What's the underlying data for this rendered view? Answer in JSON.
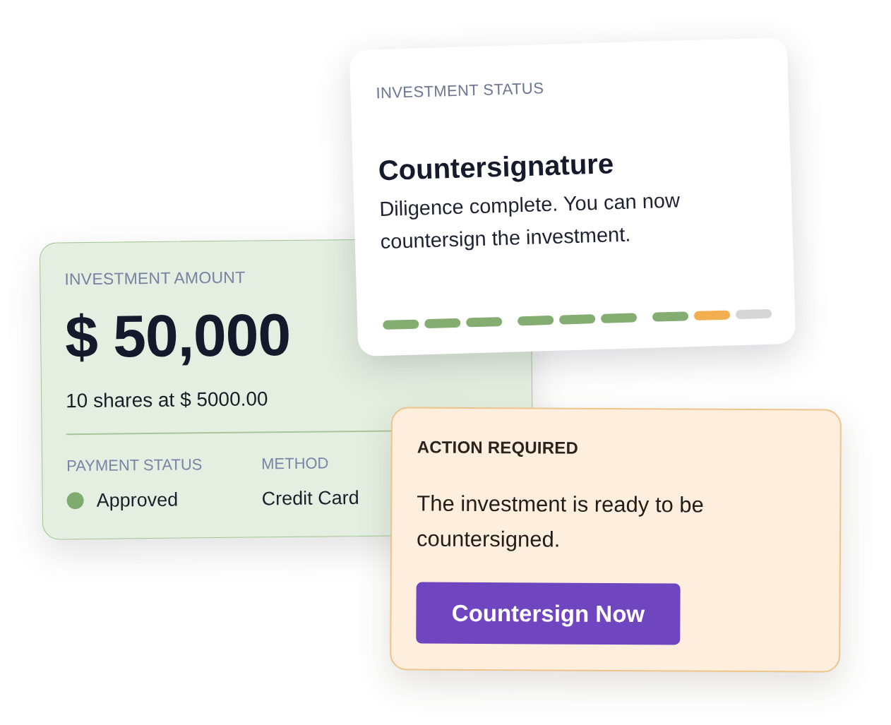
{
  "status_card": {
    "label": "INVESTMENT STATUS",
    "title": "Countersignature",
    "description": "Diligence complete. You can now countersign the investment.",
    "steps": [
      {
        "segments": [
          {
            "color": "#84ad72"
          },
          {
            "color": "#84ad72"
          },
          {
            "color": "#84ad72"
          }
        ]
      },
      {
        "segments": [
          {
            "color": "#84ad72"
          },
          {
            "color": "#84ad72"
          },
          {
            "color": "#84ad72"
          }
        ]
      },
      {
        "segments": [
          {
            "color": "#84ad72"
          },
          {
            "color": "#f3ae4f"
          },
          {
            "color": "#d6d6d6"
          }
        ]
      }
    ]
  },
  "amount_card": {
    "label": "INVESTMENT AMOUNT",
    "amount": "$ 50,000",
    "detail": "10 shares at $ 5000.00",
    "fields": [
      {
        "label": "PAYMENT STATUS",
        "value": "Approved",
        "color": "#80ab6e"
      },
      {
        "label": "METHOD",
        "value": "Credit Card"
      }
    ]
  },
  "action_card": {
    "label": "ACTION REQUIRED",
    "message": "The investment is ready to be countersigned.",
    "button": "Countersign Now"
  }
}
